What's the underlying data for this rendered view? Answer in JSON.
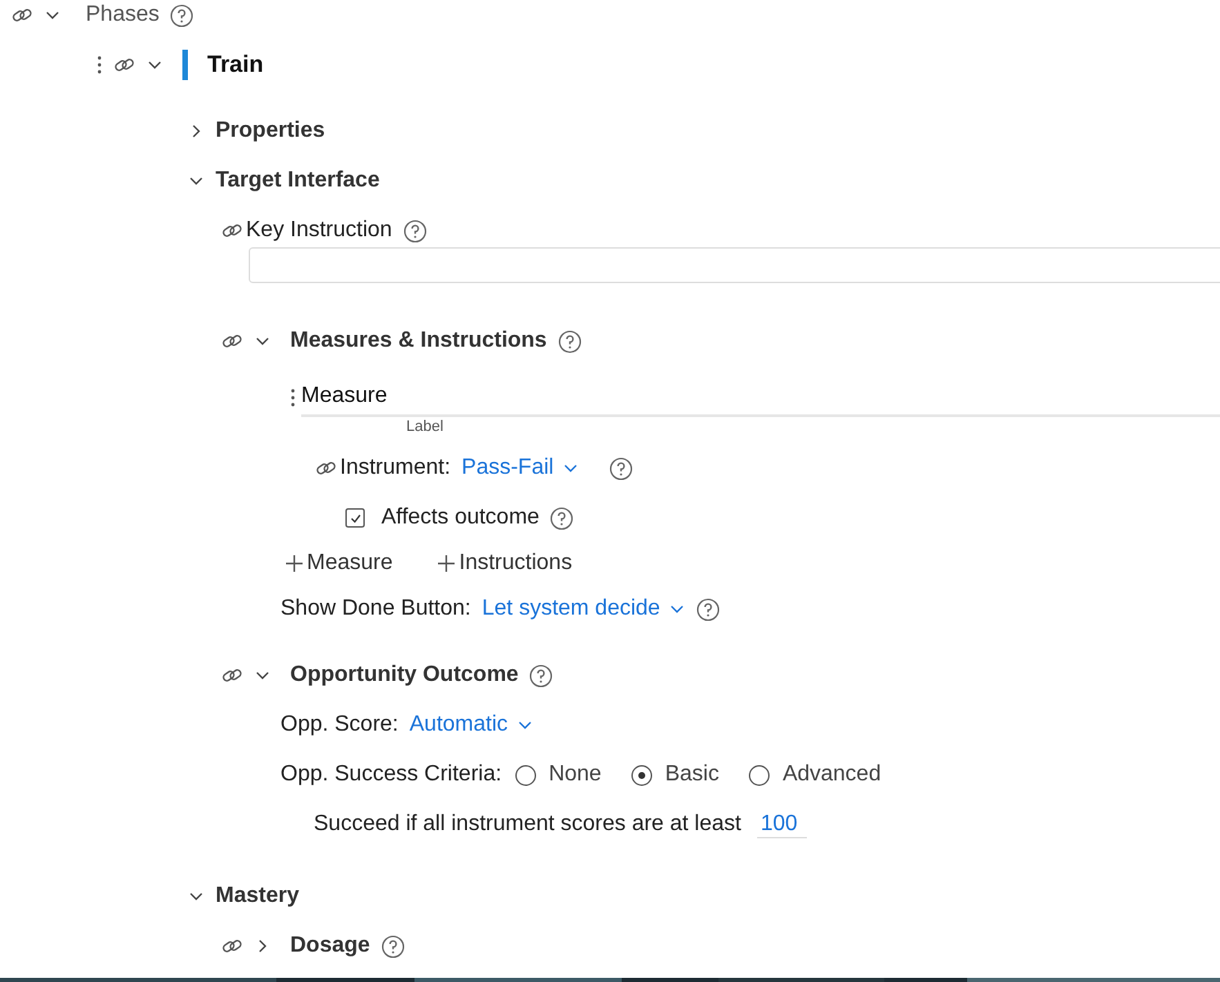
{
  "phases": {
    "label": "Phases",
    "expanded": true
  },
  "phase": {
    "title": "Train",
    "expanded": true
  },
  "properties": {
    "title": "Properties",
    "expanded": false
  },
  "target_interface": {
    "title": "Target Interface",
    "expanded": true,
    "key_instruction": {
      "label": "Key Instruction"
    },
    "measures_instructions": {
      "title": "Measures & Instructions",
      "expanded": true,
      "measure": {
        "value": "Measure",
        "caption": "Label"
      },
      "instrument": {
        "label": "Instrument:",
        "value": "Pass-Fail"
      },
      "affects_outcome": {
        "label": "Affects outcome",
        "checked": true
      },
      "add_buttons": [
        "Measure",
        "Instructions"
      ],
      "show_done": {
        "label": "Show Done Button:",
        "value": "Let system decide"
      }
    },
    "opportunity_outcome": {
      "title": "Opportunity Outcome",
      "expanded": true,
      "score": {
        "label": "Opp. Score:",
        "value": "Automatic"
      },
      "success_criteria": {
        "label": "Opp. Success Criteria:",
        "options": [
          {
            "label": "None",
            "selected": false
          },
          {
            "label": "Basic",
            "selected": true
          },
          {
            "label": "Advanced",
            "selected": false
          }
        ]
      },
      "succeed": {
        "text": "Succeed if all instrument scores are at least",
        "value": "100"
      }
    }
  },
  "mastery": {
    "title": "Mastery",
    "expanded": true,
    "dosage": {
      "title": "Dosage",
      "expanded": false
    }
  }
}
